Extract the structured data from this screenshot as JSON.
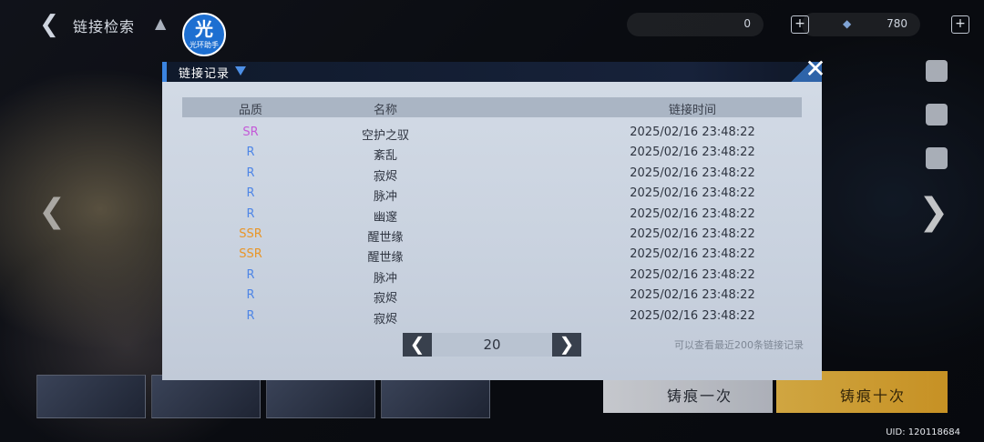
{
  "topbar": {
    "title": "链接检索",
    "resource1_value": "0",
    "resource2_value": "780",
    "badge_big": "光",
    "badge_small": "光环助手"
  },
  "dialog": {
    "title": "链接记录",
    "columns": {
      "quality": "品质",
      "name": "名称",
      "time": "链接时间"
    },
    "rows": [
      {
        "quality": "SR",
        "name": "空护之驭",
        "time": "2025/02/16 23:48:22"
      },
      {
        "quality": "R",
        "name": "紊乱",
        "time": "2025/02/16 23:48:22"
      },
      {
        "quality": "R",
        "name": "寂烬",
        "time": "2025/02/16 23:48:22"
      },
      {
        "quality": "R",
        "name": "脉冲",
        "time": "2025/02/16 23:48:22"
      },
      {
        "quality": "R",
        "name": "幽邃",
        "time": "2025/02/16 23:48:22"
      },
      {
        "quality": "SSR",
        "name": "醒世缘",
        "time": "2025/02/16 23:48:22"
      },
      {
        "quality": "SSR",
        "name": "醒世缘",
        "time": "2025/02/16 23:48:22"
      },
      {
        "quality": "R",
        "name": "脉冲",
        "time": "2025/02/16 23:48:22"
      },
      {
        "quality": "R",
        "name": "寂烬",
        "time": "2025/02/16 23:48:22"
      },
      {
        "quality": "R",
        "name": "寂烬",
        "time": "2025/02/16 23:48:22"
      }
    ],
    "page_value": "20",
    "hint": "可以查看最近200条链接记录"
  },
  "quality_colors": {
    "SR": "#c45ad8",
    "R": "#4f86e6",
    "SSR": "#e8962a"
  },
  "bottom": {
    "pull_one": "铸痕一次",
    "pull_ten": "铸痕十次",
    "uid": "UID: 120118684"
  }
}
